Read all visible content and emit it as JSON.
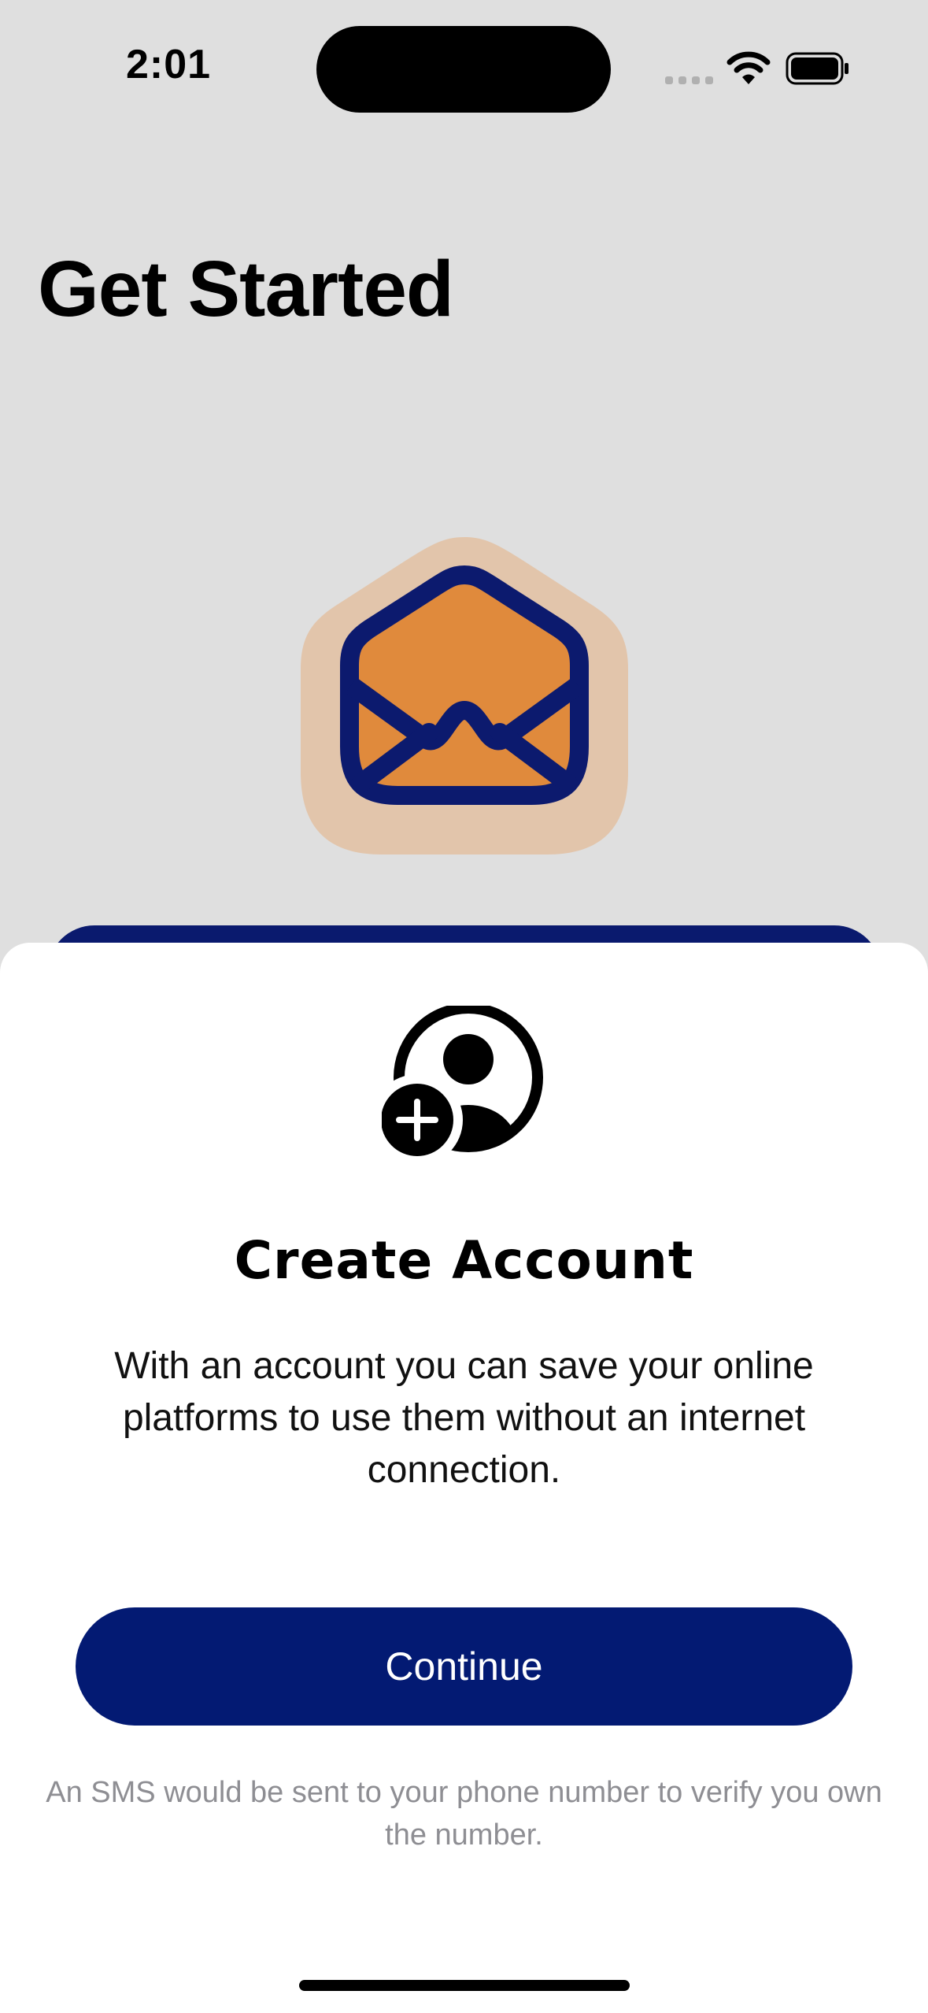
{
  "status_bar": {
    "time": "2:01"
  },
  "page": {
    "title": "Get Started"
  },
  "sheet": {
    "title": "Create Account",
    "body": "With an account you can save your online platforms to use them without an internet connection.",
    "continue_label": "Continue",
    "footnote": "An SMS would be sent to your phone number to verify you own the number."
  },
  "icons": {
    "hero": "envelope-open-icon",
    "sheet": "person-add-icon",
    "status": [
      "cellular-signal-icon",
      "wifi-icon",
      "battery-icon"
    ]
  },
  "colors": {
    "background": "#dfdfdf",
    "sheet": "#ffffff",
    "primary_button": "#031a73",
    "envelope_fill": "#e08a3c",
    "envelope_halo": "#e2c5ab",
    "envelope_stroke": "#0c1a6e",
    "footnote": "#8e8e93"
  }
}
